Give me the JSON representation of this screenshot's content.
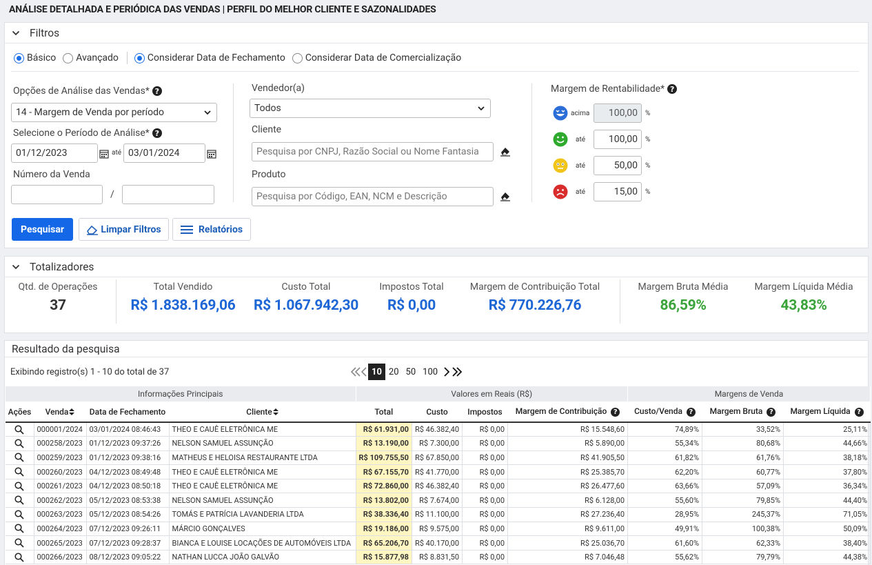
{
  "page_title": "ANÁLISE DETALHADA E PERIÓDICA DAS VENDAS | PERFIL DO MELHOR CLIENTE E SAZONALIDADES",
  "filters": {
    "title": "Filtros",
    "radio_basico": "Básico",
    "radio_avancado": "Avançado",
    "radio_fechamento": "Considerar Data de Fechamento",
    "radio_comercializacao": "Considerar Data de Comercialização",
    "analysis_options_label": "Opções de Análise das Vendas*",
    "analysis_options_value": "14 - Margem de Venda por período",
    "period_label": "Selecione o Período de Análise*",
    "date_from": "01/12/2023",
    "date_until_label": "até",
    "date_to": "03/01/2024",
    "sale_number_label": "Número da Venda",
    "sale_number_sep": "/",
    "seller_label": "Vendedor(a)",
    "seller_value": "Todos",
    "client_label": "Cliente",
    "client_placeholder": "Pesquisa por CNPJ, Razão Social ou Nome Fantasia",
    "product_label": "Produto",
    "product_placeholder": "Pesquisa por Código, EAN, NCM e Descrição",
    "margin_label": "Margem de Rentabilidade*",
    "margins": [
      {
        "face": "happy-blue",
        "prefix": "acima",
        "value": "100,00",
        "unit": "%"
      },
      {
        "face": "smile-green",
        "prefix": "até",
        "value": "100,00",
        "unit": "%"
      },
      {
        "face": "neutral-yellow",
        "prefix": "até",
        "value": "50,00",
        "unit": "%"
      },
      {
        "face": "sad-red",
        "prefix": "até",
        "value": "15,00",
        "unit": "%"
      }
    ],
    "btn_search": "Pesquisar",
    "btn_clear": "Limpar Filtros",
    "btn_reports": "Relatórios"
  },
  "totals": {
    "title": "Totalizadores",
    "ops_label": "Qtd. de Operações",
    "ops_value": "37",
    "sold_label": "Total Vendido",
    "sold_value": "R$ 1.838.169,06",
    "cost_label": "Custo Total",
    "cost_value": "R$ 1.067.942,30",
    "tax_label": "Impostos Total",
    "tax_value": "R$ 0,00",
    "contrib_label": "Margem de Contribuição Total",
    "contrib_value": "R$ 770.226,76",
    "gross_label": "Margem Bruta Média",
    "gross_value": "86,59%",
    "net_label": "Margem Líquida Média",
    "net_value": "43,83%"
  },
  "results": {
    "title": "Resultado da pesquisa",
    "showing": "Exibindo registro(s) 1 - 10 do total de 37",
    "page_sizes": [
      "10",
      "20",
      "50",
      "100"
    ],
    "group_headers": [
      "Informações Principais",
      "Valores em Reais (R$)",
      "Margens de Venda"
    ],
    "columns": [
      "Ações",
      "Venda",
      "Data de Fechamento",
      "Cliente",
      "Total",
      "Custo",
      "Impostos",
      "Margem de Contribuição",
      "Custo/Venda",
      "Margem Bruta",
      "Margem Líquida"
    ],
    "rows": [
      [
        "000001/2024",
        "03/01/2024 08:46:43",
        "THEO E CAUÊ ELETRÔNICA ME",
        "R$ 61.931,00",
        "R$ 46.382,40",
        "R$ 0,00",
        "R$ 15.548,60",
        "74,89%",
        "33,52%",
        "25,11%"
      ],
      [
        "000258/2023",
        "01/12/2023 09:37:26",
        "NELSON SAMUEL ASSUNÇÃO",
        "R$ 13.190,00",
        "R$ 7.300,00",
        "R$ 0,00",
        "R$ 5.890,00",
        "55,34%",
        "80,68%",
        "44,66%"
      ],
      [
        "000259/2023",
        "01/12/2023 09:38:16",
        "MATHEUS E HELOISA RESTAURANTE LTDA",
        "R$ 109.755,50",
        "R$ 67.850,00",
        "R$ 0,00",
        "R$ 41.905,50",
        "61,82%",
        "61,76%",
        "38,18%"
      ],
      [
        "000260/2023",
        "04/12/2023 08:49:48",
        "THEO E CAUÊ ELETRÔNICA ME",
        "R$ 67.155,70",
        "R$ 41.770,00",
        "R$ 0,00",
        "R$ 25.385,70",
        "62,20%",
        "60,77%",
        "37,80%"
      ],
      [
        "000261/2023",
        "04/12/2023 08:50:18",
        "THEO E CAUÊ ELETRÔNICA ME",
        "R$ 72.860,00",
        "R$ 46.382,40",
        "R$ 0,00",
        "R$ 26.477,60",
        "63,66%",
        "57,09%",
        "36,34%"
      ],
      [
        "000262/2023",
        "05/12/2023 08:53:38",
        "NELSON SAMUEL ASSUNÇÃO",
        "R$ 13.802,00",
        "R$ 7.674,00",
        "R$ 0,00",
        "R$ 6.128,00",
        "55,60%",
        "79,85%",
        "44,40%"
      ],
      [
        "000263/2023",
        "05/12/2023 08:54:26",
        "TOMÁS E PATRÍCIA LAVANDERIA LTDA",
        "R$ 38.336,40",
        "R$ 11.100,00",
        "R$ 0,00",
        "R$ 27.236,40",
        "28,95%",
        "245,37%",
        "71,05%"
      ],
      [
        "000264/2023",
        "07/12/2023 09:26:11",
        "MÁRCIO GONÇALVES",
        "R$ 19.186,00",
        "R$ 9.575,00",
        "R$ 0,00",
        "R$ 9.611,00",
        "49,91%",
        "100,38%",
        "50,09%"
      ],
      [
        "000265/2023",
        "07/12/2023 09:28:37",
        "BIANCA E LOUISE LOCAÇÕES DE AUTOMÓVEIS LTDA",
        "R$ 65.206,70",
        "R$ 40.170,00",
        "R$ 0,00",
        "R$ 25.036,70",
        "61,60%",
        "62,33%",
        "38,40%"
      ],
      [
        "000266/2023",
        "08/12/2023 09:05:22",
        "NATHAN LUCCA JOÃO GALVÃO",
        "R$ 15.877,98",
        "R$ 8.831,50",
        "R$ 0,00",
        "R$ 7.046,48",
        "55,62%",
        "79,79%",
        "44,38%"
      ]
    ]
  }
}
